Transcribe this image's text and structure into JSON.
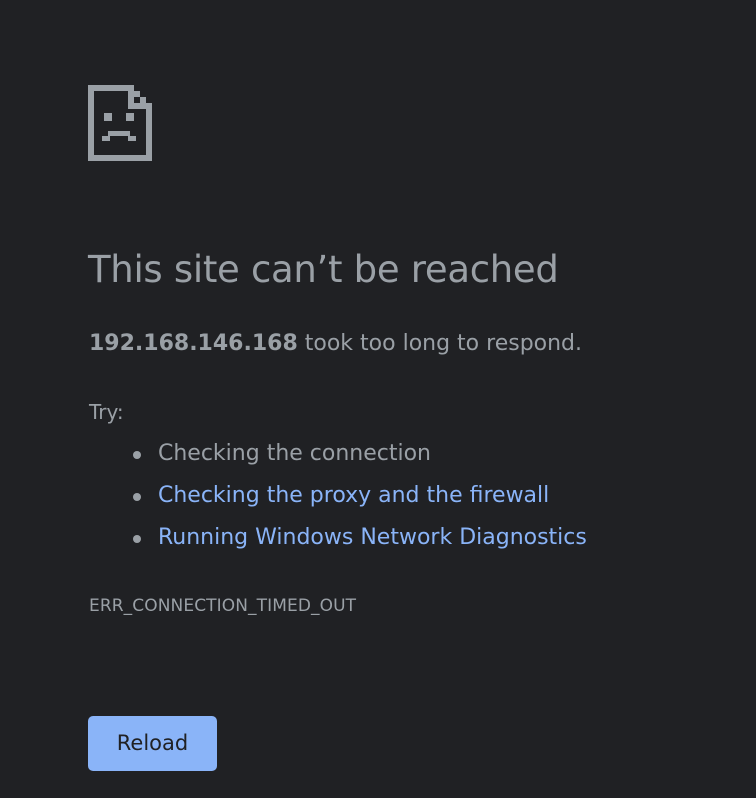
{
  "error_page": {
    "icon": "sad-page-icon",
    "title": "This site can’t be reached",
    "host": "192.168.146.168",
    "summary_suffix": " took too long to respond.",
    "try_label": "Try:",
    "suggestions": [
      {
        "label": "Checking the connection",
        "is_link": false
      },
      {
        "label": "Checking the proxy and the firewall",
        "is_link": true
      },
      {
        "label": "Running Windows Network Diagnostics",
        "is_link": true
      }
    ],
    "error_code": "ERR_CONNECTION_TIMED_OUT",
    "reload_label": "Reload"
  },
  "colors": {
    "background": "#202124",
    "text": "#9aa0a6",
    "link": "#8ab4f8",
    "button": "#8ab4f8",
    "button_text": "#202124"
  }
}
